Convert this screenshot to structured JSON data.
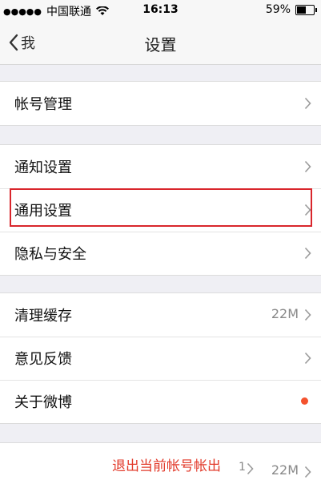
{
  "status_bar": {
    "signal_dots": "●●●●●",
    "carrier": "中国联通",
    "time": "16:13",
    "battery_pct": "59%",
    "battery_level": 0.59
  },
  "nav": {
    "back_label": "我",
    "title": "设置"
  },
  "sections": [
    {
      "items": [
        {
          "label": "帐号管理"
        }
      ]
    },
    {
      "items": [
        {
          "label": "通知设置"
        },
        {
          "label": "通用设置"
        },
        {
          "label": "隐私与安全"
        }
      ]
    },
    {
      "items": [
        {
          "label": "清理缓存",
          "value": "22M"
        },
        {
          "label": "意见反馈"
        },
        {
          "label": "关于微博",
          "badge": "new-dot"
        }
      ]
    }
  ],
  "footer": {
    "logout_label": "退出当前帐号帐出",
    "extra_text": "1",
    "extra_value": "22M"
  },
  "colors": {
    "accent_red": "#e23a2a",
    "highlight_red": "#d9262c",
    "dot": "#f4522e"
  }
}
